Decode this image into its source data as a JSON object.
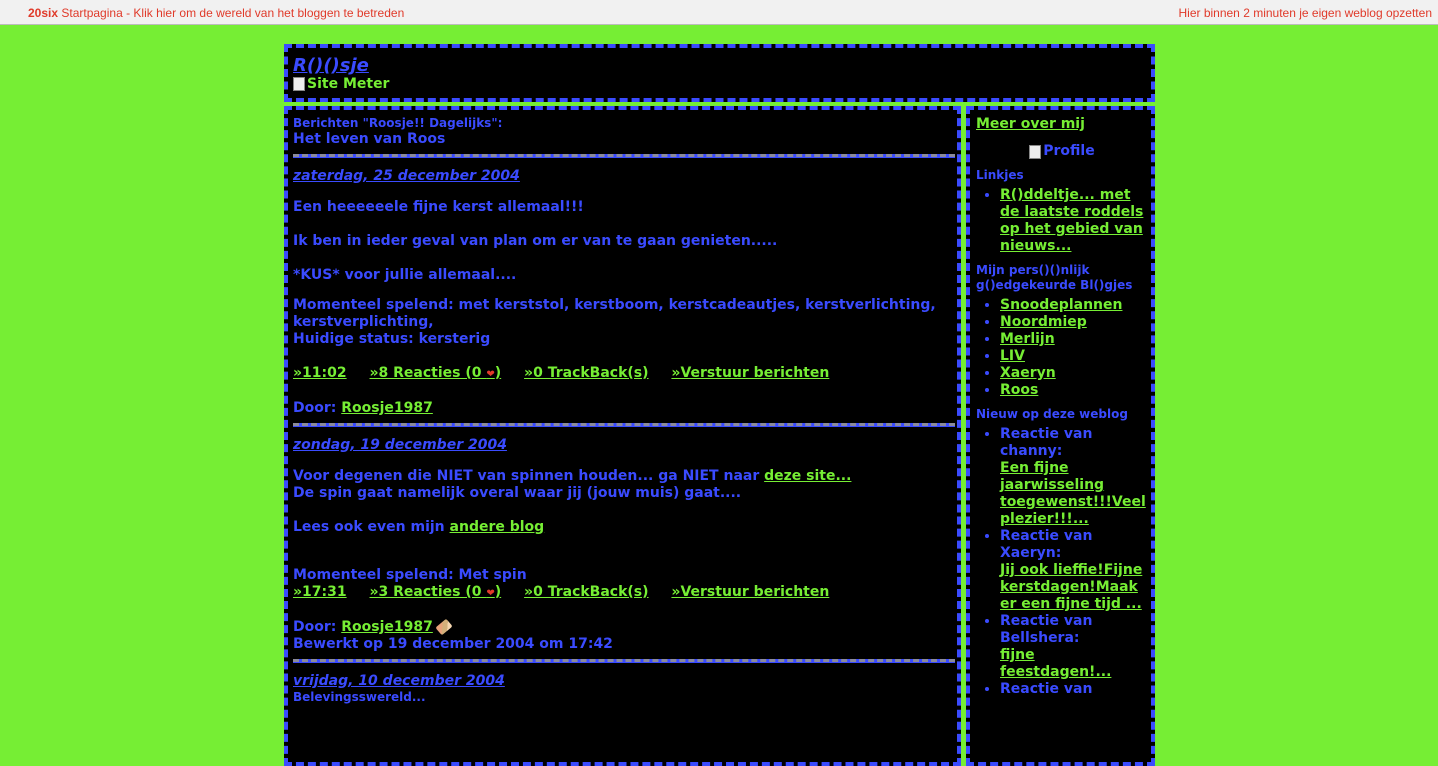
{
  "topbar": {
    "brand": "20six",
    "left_text": " Startpagina - Klik hier om de wereld van het bloggen te betreden",
    "right_text": "Hier binnen 2 minuten je eigen weblog opzetten"
  },
  "header": {
    "title": "R()()sje",
    "site_meter_alt": "Site Meter"
  },
  "main": {
    "intro_label": "Berichten \"Roosje!! Dagelijks\":",
    "intro_title": "Het leven van Roos",
    "posts": [
      {
        "date": "zaterdag, 25 december 2004",
        "line1": "Een heeeeeele fijne kerst allemaal!!!",
        "line2": "Ik ben in ieder geval van plan om er van te gaan genieten.....",
        "line3": "*KUS* voor jullie allemaal....",
        "playing": "Momenteel spelend: met kerststol, kerstboom, kerstcadeautjes, kerstverlichting, kerstverplichting,",
        "status": "Huidige status: kersterig",
        "time": "»11:02",
        "reactions": "»8 Reacties (0 ",
        "reactions_end": ")",
        "trackback": "»0 TrackBack(s)",
        "send": "»Verstuur berichten",
        "by_label": "Door: ",
        "author": "Roosje1987"
      },
      {
        "date": "zondag, 19 december 2004",
        "line1_pre": "Voor degenen die NIET van spinnen houden... ga NIET naar ",
        "line1_link": "deze site...",
        "line2": "De spin gaat namelijk overal waar jij (jouw muis) gaat....",
        "line3_pre": "Lees ook even mijn ",
        "line3_link": "andere blog",
        "playing": "Momenteel spelend: Met spin",
        "time": "»17:31",
        "reactions": "»3 Reacties (0 ",
        "reactions_end": ")",
        "trackback": "»0 TrackBack(s)",
        "send": "»Verstuur berichten",
        "by_label": "Door: ",
        "author": "Roosje1987",
        "edited": "Bewerkt op 19 december 2004 om 17:42"
      },
      {
        "date": "vrijdag, 10 december 2004",
        "subtitle": "Belevingsswereld..."
      }
    ]
  },
  "sidebar": {
    "about": "Meer over mij",
    "profile_alt": "Profile",
    "links_head": "Linkjes",
    "links": [
      "R()ddeltje... met de laatste roddels op het gebied van nieuws..."
    ],
    "blogs_head": "Mijn pers()()nlijk g()edgekeurde Bl()gjes",
    "blogs": [
      "Snoodeplannen",
      "Noordmiep",
      "Merlijn",
      "LIV",
      "Xaeryn",
      "Roos"
    ],
    "new_head": "Nieuw op deze weblog",
    "new_items": [
      {
        "label": "Reactie van channy:",
        "link": "Een fijne jaarwisseling toegewenst!!!Veel plezier!!!..."
      },
      {
        "label": "Reactie van Xaeryn:",
        "link": "Jij ook lieffie!Fijne kerstdagen!Maak er een fijne tijd ..."
      },
      {
        "label": "Reactie van Bellshera:",
        "link": "fijne feestdagen!..."
      },
      {
        "label": "Reactie van",
        "link": ""
      }
    ]
  }
}
